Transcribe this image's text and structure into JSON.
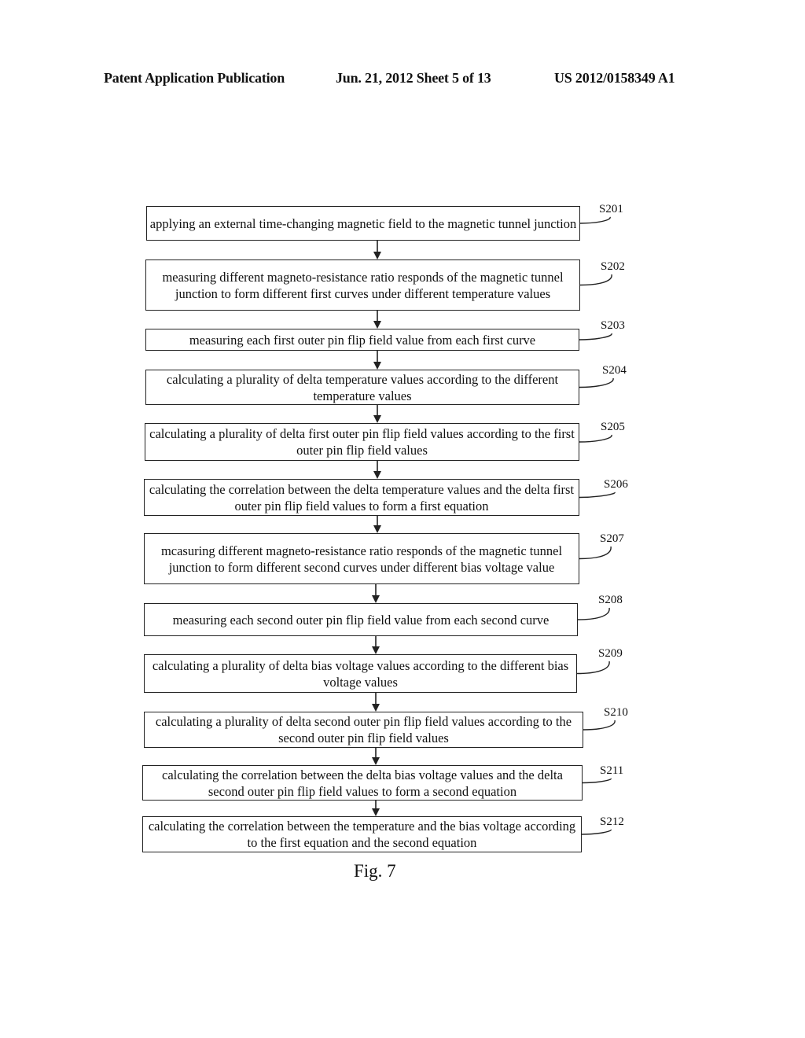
{
  "header": {
    "publication": "Patent Application Publication",
    "date_sheet": "Jun. 21, 2012  Sheet 5 of 13",
    "number": "US 2012/0158349 A1"
  },
  "steps": [
    {
      "id": "S201",
      "text": "applying an external time-changing magnetic field to the magnetic tunnel junction"
    },
    {
      "id": "S202",
      "text": "measuring different magneto-resistance ratio responds of the magnetic tunnel junction to form different first curves under different temperature values"
    },
    {
      "id": "S203",
      "text": "measuring each first outer pin flip field value from each first curve"
    },
    {
      "id": "S204",
      "text": "calculating a plurality of delta temperature values according to the different temperature values"
    },
    {
      "id": "S205",
      "text": "calculating a plurality of delta first outer pin flip field values according to the first outer pin flip field values"
    },
    {
      "id": "S206",
      "text": "calculating the correlation between the delta temperature values and the delta first outer pin flip field values to form a first equation"
    },
    {
      "id": "S207",
      "text": "mcasuring different magneto-resistance ratio responds of the magnetic tunnel junction to form different second curves under different bias voltage value"
    },
    {
      "id": "S208",
      "text": "measuring each second outer pin flip field value from each second curve"
    },
    {
      "id": "S209",
      "text": "calculating a plurality of delta bias voltage values according to the different bias voltage values"
    },
    {
      "id": "S210",
      "text": "calculating a plurality of delta second outer pin flip field values according to the second outer pin flip field values"
    },
    {
      "id": "S211",
      "text": "calculating the correlation between the delta bias voltage values and the delta second outer pin flip field values to form a second equation"
    },
    {
      "id": "S212",
      "text": "calculating the correlation between the temperature and the bias voltage according to the first equation and the second equation"
    }
  ],
  "caption": "Fig. 7"
}
